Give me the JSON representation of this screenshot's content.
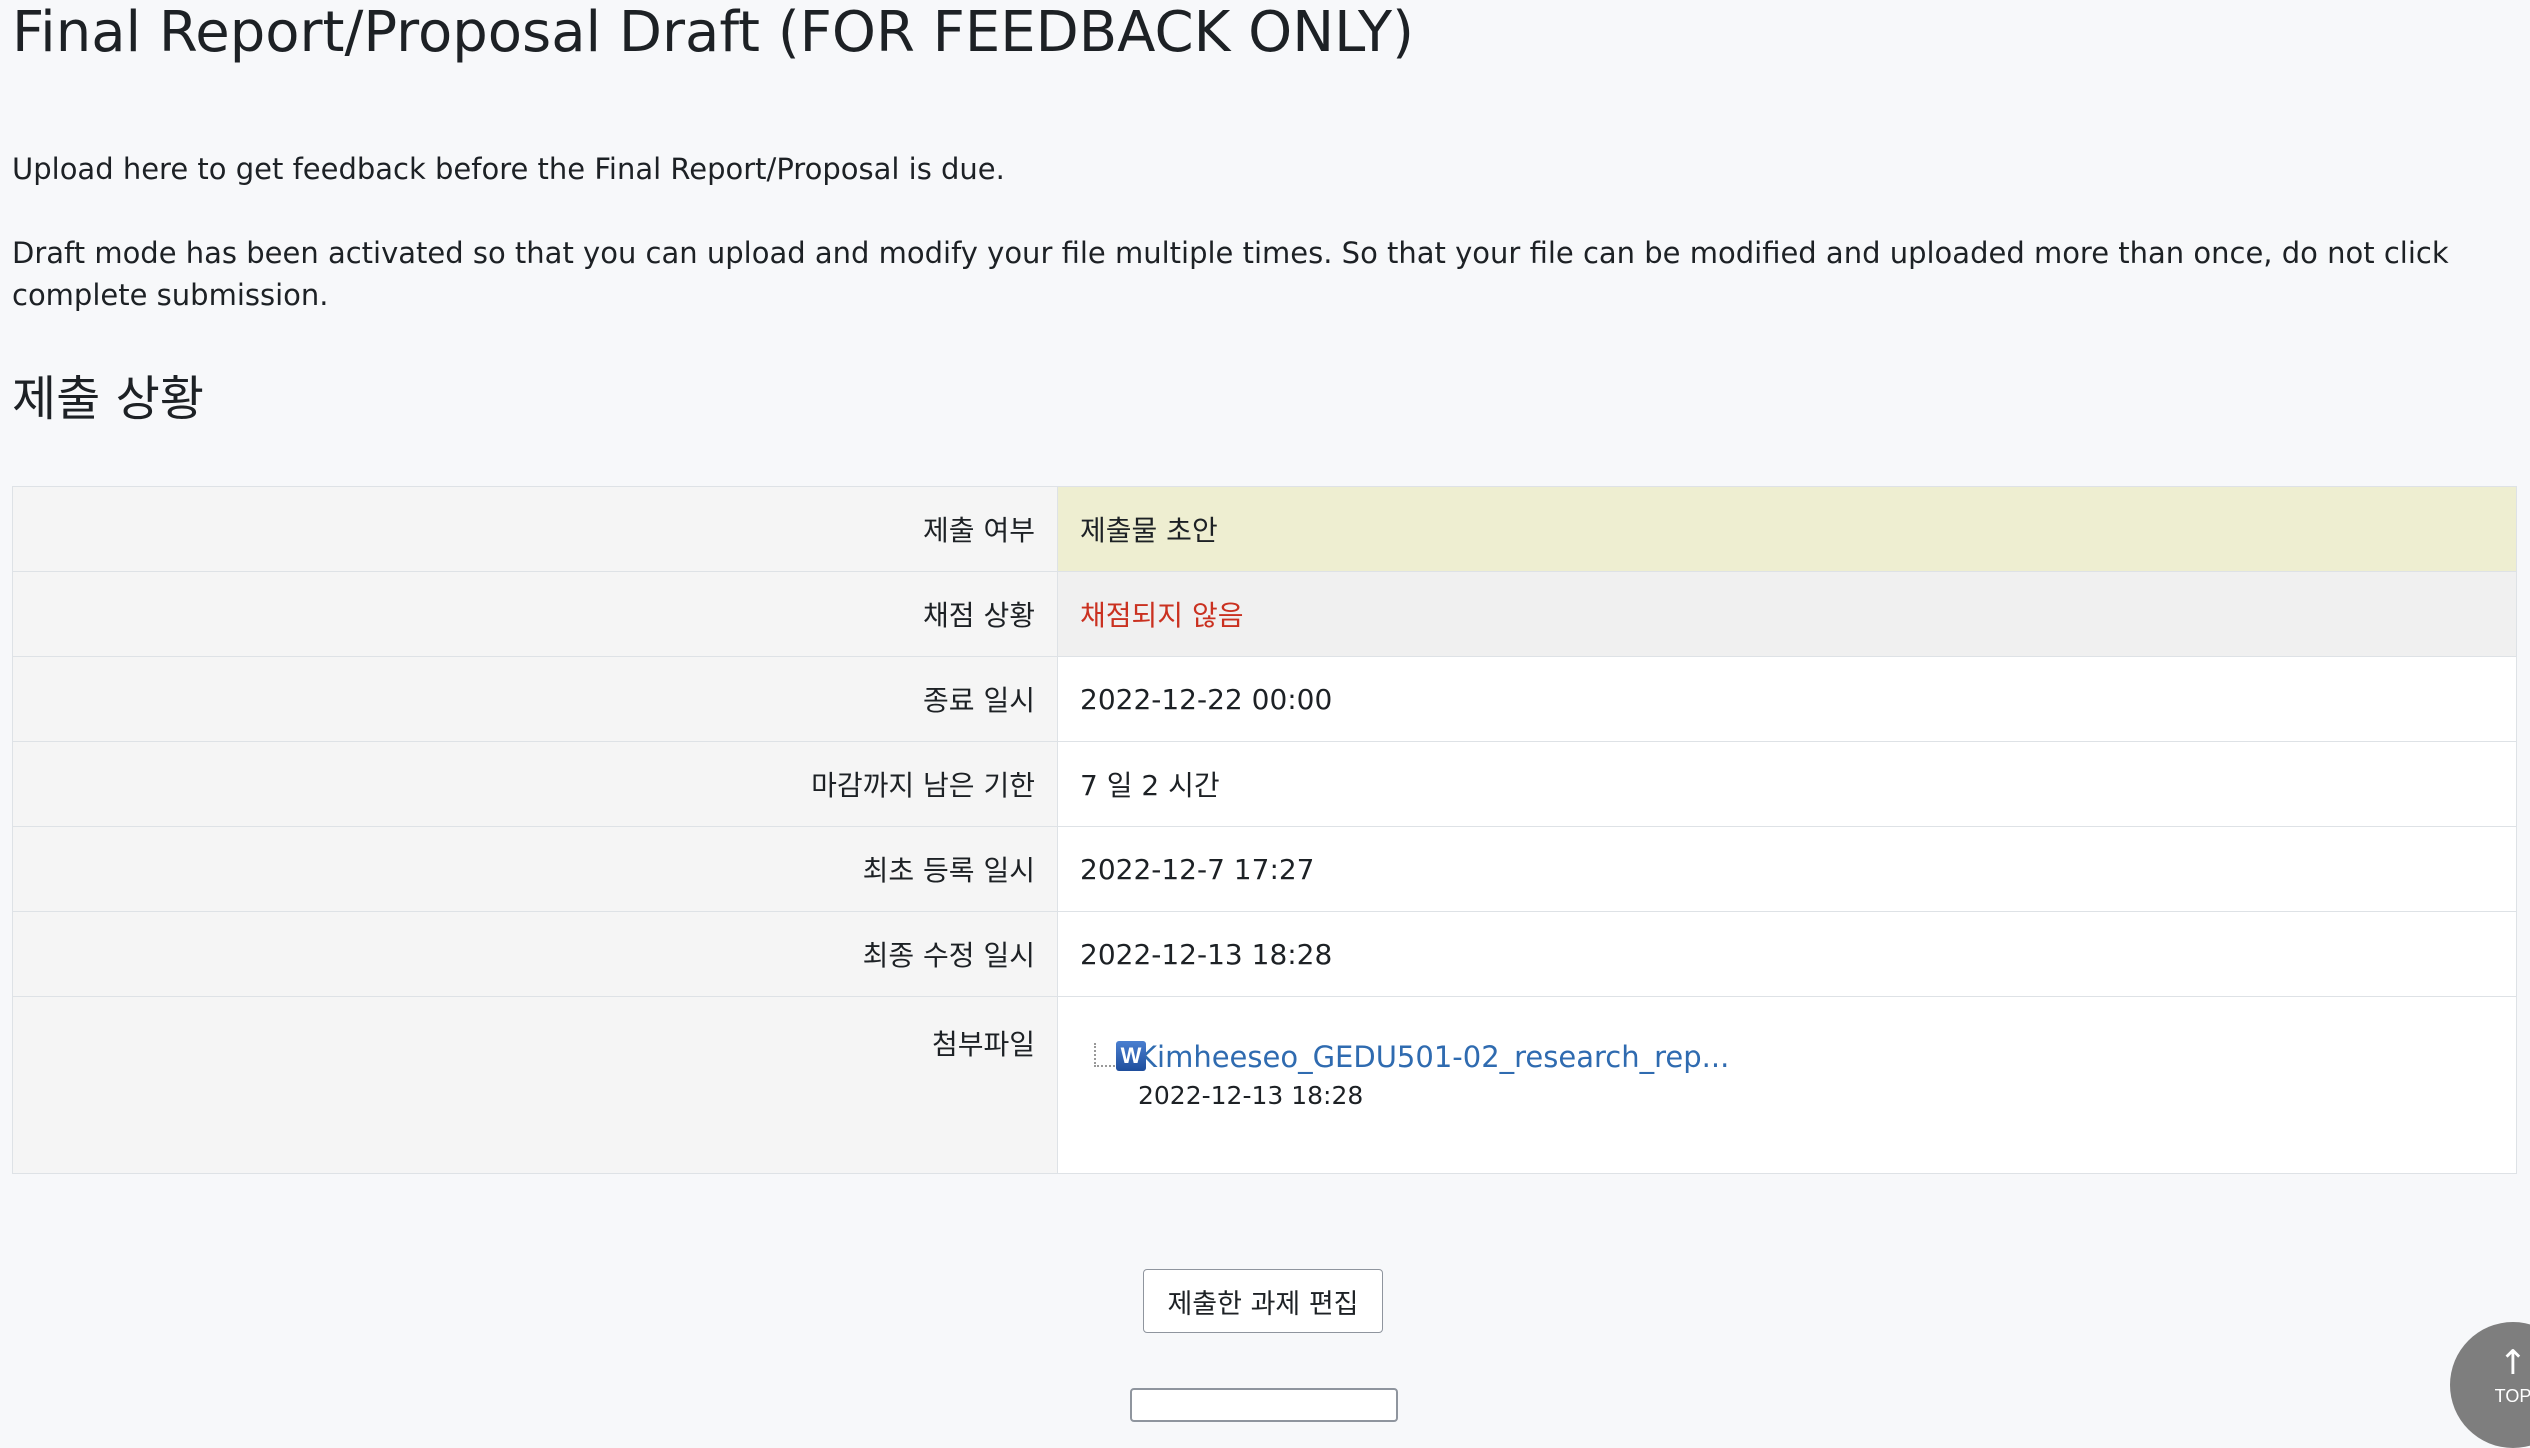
{
  "page": {
    "title": "Final Report/Proposal Draft (FOR FEEDBACK ONLY)",
    "intro": [
      "Upload here to get feedback before the Final Report/Proposal is due.",
      "Draft mode has been activated so that you can upload and modify your file multiple times. So that your file can be modified and uploaded more than once,  do not click complete submission."
    ]
  },
  "submission_status": {
    "heading": "제출 상황",
    "rows": [
      {
        "label": "제출 여부",
        "value": "제출물 초안"
      },
      {
        "label": "채점 상황",
        "value": "채점되지 않음"
      },
      {
        "label": "종료 일시",
        "value": "2022-12-22 00:00"
      },
      {
        "label": "마감까지 남은 기한",
        "value": "7 일 2 시간"
      },
      {
        "label": "최초 등록 일시",
        "value": "2022-12-7 17:27"
      },
      {
        "label": "최종 수정 일시",
        "value": "2022-12-13 18:28"
      },
      {
        "label": "첨부파일",
        "value": ""
      }
    ],
    "file": {
      "icon": "word-doc-icon",
      "name": "Kimheeseo_GEDU501-02_research_rep...",
      "date": "2022-12-13 18:28"
    }
  },
  "actions": {
    "edit_label": "제출한 과제 편집"
  },
  "top_button": {
    "arrow": "↑",
    "label": "TOP"
  },
  "colors": {
    "submitted_bg": "#eeeed1",
    "not_graded_text": "#ca3120",
    "link": "#2f6bb0"
  }
}
